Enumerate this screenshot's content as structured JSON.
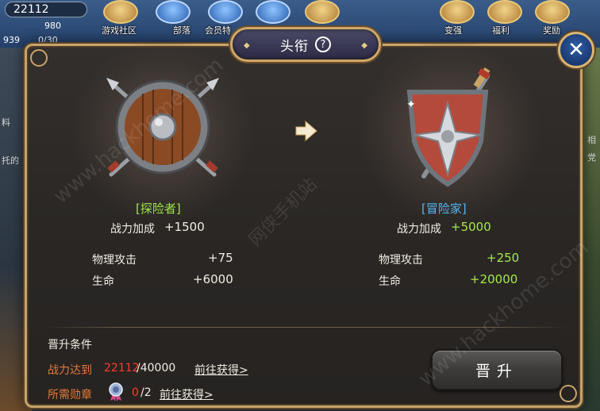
{
  "hud": {
    "currency_value": "22112",
    "sub_stat_1": "980",
    "sub_stat_2": "939",
    "sub_stat_3": "0/30",
    "top_menu": [
      {
        "label": "游戏社区"
      },
      {
        "label": "部落"
      },
      {
        "label": "会员特"
      },
      {
        "label": "变强"
      },
      {
        "label": "福利"
      },
      {
        "label": "奖励"
      }
    ],
    "side_texts": [
      "料",
      "托的",
      "相",
      "党"
    ]
  },
  "dialog": {
    "title": "头衔",
    "help_symbol": "?",
    "close_symbol": "✕",
    "current": {
      "rank_name": "[探险者]",
      "power_bonus_label": "战力加成",
      "power_bonus_value": "+1500",
      "stats": [
        {
          "label": "物理攻击",
          "value": "+75"
        },
        {
          "label": "生命",
          "value": "+6000"
        }
      ]
    },
    "next": {
      "rank_name": "[冒险家]",
      "power_bonus_label": "战力加成",
      "power_bonus_value": "+5000",
      "stats": [
        {
          "label": "物理攻击",
          "value": "+250"
        },
        {
          "label": "生命",
          "value": "+20000"
        }
      ]
    },
    "requirements": {
      "title": "晋升条件",
      "power": {
        "label": "战力达到",
        "current": "22112",
        "required": "/40000",
        "link": "前往获得>"
      },
      "medal": {
        "label": "所需勋章",
        "current": "0",
        "required": "/2",
        "link": "前往获得>"
      }
    },
    "promote_button": "晋升"
  },
  "watermarks": [
    "www.hackhome.com",
    "网侠手机站",
    "www.hackhome.com"
  ],
  "colors": {
    "frame_gold": "#c8a46a",
    "rank_current": "#9be64a",
    "rank_next": "#4fb6f0",
    "bonus_green": "#a6e84a",
    "condition_orange": "#e37a3a",
    "condition_red": "#ff3b2b"
  }
}
